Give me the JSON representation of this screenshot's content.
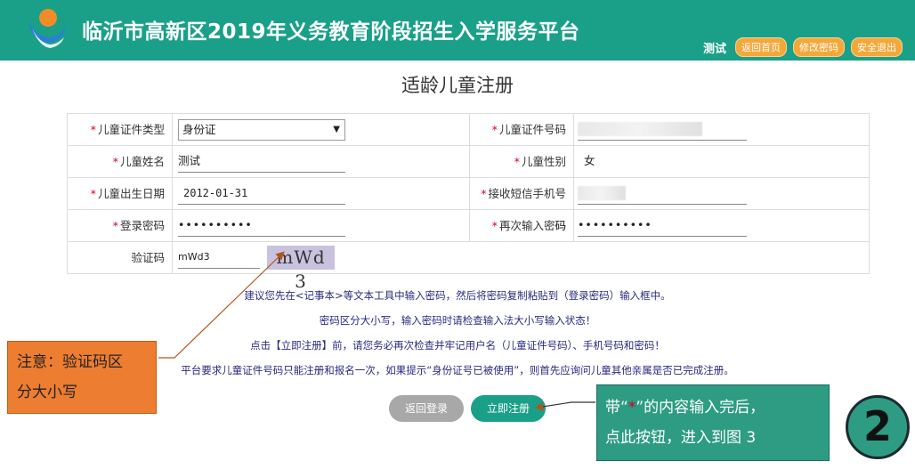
{
  "header": {
    "title": "临沂市高新区2019年义务教育阶段招生入学服务平台",
    "username": "测试",
    "links": [
      "返回首页",
      "修改密码",
      "安全退出"
    ]
  },
  "page_title": "适龄儿童注册",
  "form": {
    "id_type_label": "儿童证件类型",
    "id_type_value": "身份证",
    "id_number_label": "儿童证件号码",
    "name_label": "儿童姓名",
    "name_value": "测试",
    "gender_label": "儿童性别",
    "gender_value": "女",
    "birthdate_label": "儿童出生日期",
    "birthdate_value": "2012-01-31",
    "phone_label": "接收短信手机号码",
    "password_label": "登录密码",
    "password_value": "••••••••••",
    "confirm_label": "再次输入密码",
    "confirm_value": "••••••••••",
    "captcha_label": "验证码",
    "captcha_input": "mWd3",
    "captcha_image": "mWd 3",
    "required_mark": "*"
  },
  "notes": [
    "建议您先在<记事本>等文本工具中输入密码，然后将密码复制粘贴到（登录密码）输入框中。",
    "密码区分大小写，输入密码时请检查输入法大小写输入状态！",
    "点击【立即注册】前，请您务必再次检查并牢记用户名（儿童证件号码）、手机号码和密码！",
    "平台要求儿童证件号码只能注册和报名一次，如果提示“身份证号已被使用”，则首先应询问儿童其他亲属是否已完成注册。"
  ],
  "buttons": {
    "back": "返回登录",
    "register": "立即注册"
  },
  "annotations": {
    "left_line1": "注意：验证码区",
    "left_line2": "分大小写",
    "right_pre": "带“",
    "right_star": "*",
    "right_post": "”的内容输入完后，",
    "right_line2": "点此按钮，进入到图 3",
    "step": "2"
  },
  "colors": {
    "brand": "#1aa088",
    "pill": "#f4a83a",
    "annotation_orange": "#ed7d31",
    "annotation_teal": "#2d9c82"
  }
}
